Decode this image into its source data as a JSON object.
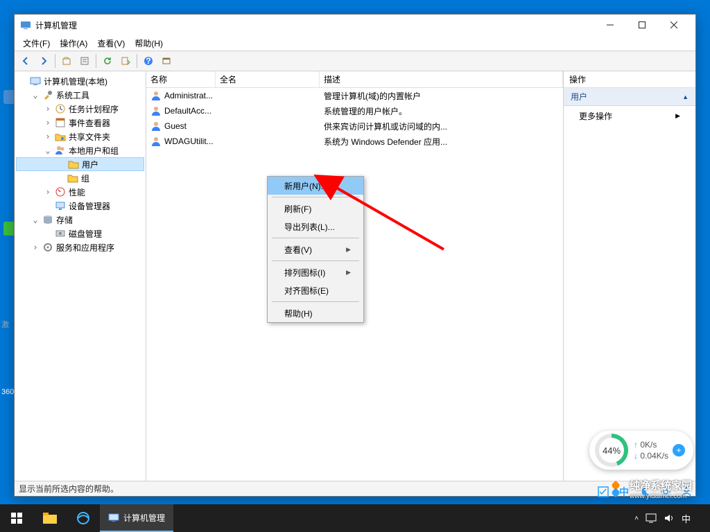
{
  "window": {
    "title": "计算机管理",
    "menus": [
      "文件(F)",
      "操作(A)",
      "查看(V)",
      "帮助(H)"
    ],
    "status": "显示当前所选内容的帮助。"
  },
  "columns": {
    "name": "名称",
    "full": "全名",
    "desc": "描述"
  },
  "tree": [
    {
      "indent": 0,
      "exp": "",
      "icon": "computer",
      "label": "计算机管理(本地)"
    },
    {
      "indent": 1,
      "exp": "v",
      "icon": "tools",
      "label": "系统工具"
    },
    {
      "indent": 2,
      "exp": ">",
      "icon": "clock",
      "label": "任务计划程序"
    },
    {
      "indent": 2,
      "exp": ">",
      "icon": "event",
      "label": "事件查看器"
    },
    {
      "indent": 2,
      "exp": ">",
      "icon": "folder-share",
      "label": "共享文件夹"
    },
    {
      "indent": 2,
      "exp": "v",
      "icon": "users",
      "label": "本地用户和组"
    },
    {
      "indent": 3,
      "exp": "",
      "icon": "folder",
      "label": "用户",
      "selected": true
    },
    {
      "indent": 3,
      "exp": "",
      "icon": "folder",
      "label": "组"
    },
    {
      "indent": 2,
      "exp": ">",
      "icon": "perf",
      "label": "性能"
    },
    {
      "indent": 2,
      "exp": "",
      "icon": "device",
      "label": "设备管理器"
    },
    {
      "indent": 1,
      "exp": "v",
      "icon": "storage",
      "label": "存储"
    },
    {
      "indent": 2,
      "exp": "",
      "icon": "disk",
      "label": "磁盘管理"
    },
    {
      "indent": 1,
      "exp": ">",
      "icon": "services",
      "label": "服务和应用程序"
    }
  ],
  "users": [
    {
      "name": "Administrat...",
      "full": "",
      "desc": "管理计算机(域)的内置帐户"
    },
    {
      "name": "DefaultAcc...",
      "full": "",
      "desc": "系统管理的用户帐户。"
    },
    {
      "name": "Guest",
      "full": "",
      "desc": "供来宾访问计算机或访问域的内..."
    },
    {
      "name": "WDAGUtilit...",
      "full": "",
      "desc": "系统为 Windows Defender 应用..."
    }
  ],
  "actions": {
    "header": "操作",
    "group": "用户",
    "more": "更多操作"
  },
  "context": [
    {
      "label": "新用户(N)...",
      "hover": true,
      "arrow": false
    },
    {
      "sep": true
    },
    {
      "label": "刷新(F)",
      "arrow": false
    },
    {
      "label": "导出列表(L)...",
      "arrow": false
    },
    {
      "sep": true
    },
    {
      "label": "查看(V)",
      "arrow": true
    },
    {
      "sep": true
    },
    {
      "label": "排列图标(I)",
      "arrow": true
    },
    {
      "label": "对齐图标(E)",
      "arrow": false
    },
    {
      "sep": true
    },
    {
      "label": "帮助(H)",
      "arrow": false
    }
  ],
  "gauge": {
    "percent": "44%",
    "up": "0K/s",
    "down": "0.04K/s"
  },
  "taskbar": {
    "app": "计算机管理"
  },
  "watermark": {
    "title": "纯净系统家园",
    "sub": "www.yidaimei.com"
  },
  "desktop": {
    "label_360": "360",
    "label_activate": "激"
  }
}
